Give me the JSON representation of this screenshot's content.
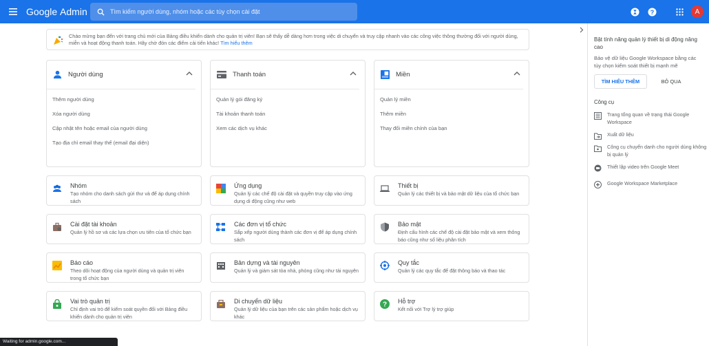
{
  "topbar": {
    "brand_google": "Google",
    "brand_admin": "Admin",
    "search_placeholder": "Tìm kiếm người dùng, nhóm hoặc các tùy chọn cài đặt",
    "avatar_letter": "A",
    "color": "#1a73e8"
  },
  "banner": {
    "text": "Chào mừng bạn đến với trang chủ mới của Bảng điều khiển dành cho quản trị viên! Bạn sẽ thấy dễ dàng hơn trong việc di chuyển và truy cập nhanh vào các công việc thông thường đối với người dùng, miễn và hoạt động thanh toán. Hãy chờ đón các điểm cải tiến khác!",
    "link": "Tìm hiểu thêm"
  },
  "big_cards": [
    {
      "title": "Người dùng",
      "icon": "person-icon",
      "links": [
        "Thêm người dùng",
        "Xóa người dùng",
        "Cập nhật tên hoặc email của người dùng",
        "Tạo địa chỉ email thay thế (email đại diện)"
      ]
    },
    {
      "title": "Thanh toán",
      "icon": "credit-card-icon",
      "links": [
        "Quản lý gói đăng ký",
        "Tài khoản thanh toán",
        "Xem các dịch vụ khác"
      ]
    },
    {
      "title": "Miền",
      "icon": "domain-icon",
      "links": [
        "Quản lý miền",
        "Thêm miền",
        "Thay đổi miền chính của bạn"
      ]
    }
  ],
  "small_cards": [
    {
      "title": "Nhóm",
      "desc": "Tạo nhóm cho danh sách gửi thư và để áp dụng chính sách",
      "icon": "groups-icon"
    },
    {
      "title": "Ứng dụng",
      "desc": "Quản lý các chế độ cài đặt và quyền truy cập vào ứng dụng di động cũng như web",
      "icon": "apps-icon"
    },
    {
      "title": "Thiết bị",
      "desc": "Quản lý các thiết bị và bảo mật dữ liệu của tổ chức bạn",
      "icon": "laptop-icon"
    },
    {
      "title": "Cài đặt tài khoản",
      "desc": "Quản lý hồ sơ và các lựa chọn ưu tiên của tổ chức bạn",
      "icon": "briefcase-icon"
    },
    {
      "title": "Các đơn vị tổ chức",
      "desc": "Sắp xếp người dùng thành các đơn vị để áp dụng chính sách",
      "icon": "org-units-icon"
    },
    {
      "title": "Bảo mật",
      "desc": "Định cấu hình các chế độ cài đặt bảo mật và xem thông báo cũng như số liệu phân tích",
      "icon": "shield-icon"
    },
    {
      "title": "Báo cáo",
      "desc": "Theo dõi hoạt động của người dùng và quản trị viên trong tổ chức bạn",
      "icon": "reports-icon"
    },
    {
      "title": "Bản dựng và tài nguyên",
      "desc": "Quản lý và giám sát tòa nhà, phòng cũng như tài nguyên",
      "icon": "buildings-icon"
    },
    {
      "title": "Quy tắc",
      "desc": "Quản lý các quy tắc để đặt thông báo và thao tác",
      "icon": "rules-icon"
    },
    {
      "title": "Vai trò quản trị",
      "desc": "Chỉ định vai trò để kiểm soát quyền đối với Bảng điều khiển dành cho quản trị viên",
      "icon": "admin-roles-icon"
    },
    {
      "title": "Di chuyển dữ liệu",
      "desc": "Quản lý dữ liệu của bạn trên các sản phẩm hoặc dịch vụ khác",
      "icon": "data-migration-icon"
    },
    {
      "title": "Hỗ trợ",
      "desc": "Kết nối với Trợ lý trợ giúp",
      "icon": "help-icon"
    }
  ],
  "right_panel": {
    "title": "Bật tính năng quản lý thiết bị di động nâng cao",
    "desc": "Bảo vệ dữ liệu Google Workspace bằng các tùy chọn kiểm soát thiết bị mạnh mẽ",
    "learn_more": "TÌM HIỂU THÊM",
    "skip": "BỎ QUA",
    "tools_heading": "Công cụ",
    "tools": [
      {
        "label": "Trang tổng quan về trạng thái Google Workspace",
        "icon": "dashboard-icon"
      },
      {
        "label": "Xuất dữ liệu",
        "icon": "export-icon"
      },
      {
        "label": "Công cụ chuyển danh cho người dùng không bị quản lý",
        "icon": "folder-transfer-icon"
      },
      {
        "label": "Thiết lập video trên Google Meet",
        "icon": "meet-icon"
      },
      {
        "label": "Google Workspace Marketplace",
        "icon": "marketplace-icon"
      }
    ]
  },
  "status_bar": "Waiting for admin.google.com..."
}
